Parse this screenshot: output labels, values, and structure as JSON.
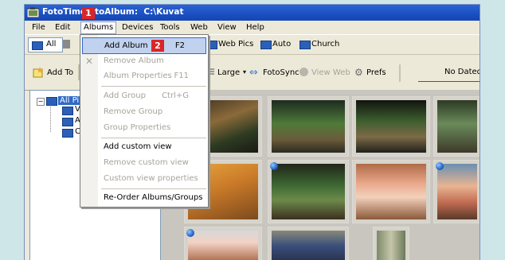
{
  "window": {
    "title": "FotoTime   toAlbum:  C:\\Kuvat",
    "app_icon": "album-icon"
  },
  "menubar": {
    "items": [
      "File",
      "Edit",
      "Albums",
      "Devices",
      "Tools",
      "Web",
      "View",
      "Help"
    ],
    "active": "Albums"
  },
  "toolbar1": {
    "all_label": "All",
    "items": [
      "Web Pics",
      "Auto",
      "Church"
    ]
  },
  "toolbar2": {
    "add_label": "Add To",
    "large_label": "Large",
    "fotosync_label": "FotoSync",
    "viewweb_label": "View Web",
    "prefs_label": "Prefs",
    "nodated_label": "No Dated"
  },
  "tree": {
    "root_label": "All Pi",
    "children": [
      "V",
      "A",
      "C"
    ]
  },
  "menu": {
    "items": [
      {
        "label": "Add Album",
        "shortcut": "F2",
        "enabled": true,
        "highlighted": true
      },
      {
        "label": "Remove Album",
        "shortcut": "",
        "enabled": false
      },
      {
        "label": "Album Properties",
        "shortcut": "F11",
        "enabled": false
      },
      {
        "label": "Add Group",
        "shortcut": "Ctrl+G",
        "enabled": false
      },
      {
        "label": "Remove Group",
        "shortcut": "",
        "enabled": false
      },
      {
        "label": "Group Properties",
        "shortcut": "",
        "enabled": false
      },
      {
        "label": "Add custom view",
        "shortcut": "",
        "enabled": true
      },
      {
        "label": "Remove custom view",
        "shortcut": "",
        "enabled": false
      },
      {
        "label": "Custom view properties",
        "shortcut": "",
        "enabled": false
      },
      {
        "label": "Re-Order Albums/Groups",
        "shortcut": "",
        "enabled": true
      }
    ]
  },
  "callouts": {
    "one": "1",
    "two": "2"
  },
  "colors": {
    "accent": "#316ac5",
    "callout": "#d9262a",
    "titlebar": "#1a4fc1"
  }
}
